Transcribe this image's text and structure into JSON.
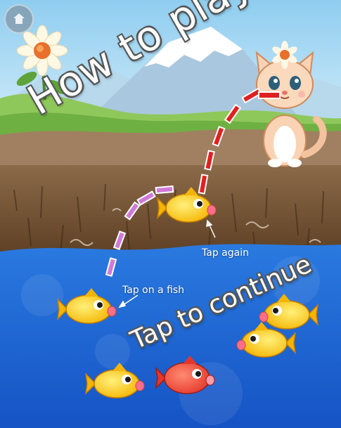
{
  "title": "How to play",
  "call_to_action": "Tap to continue",
  "hints": {
    "first": "Tap on a fish",
    "second": "Tap again"
  },
  "home_button": {
    "icon": "home-icon"
  },
  "colors": {
    "sky": "#9fd6f2",
    "soil": "#6a4a2e",
    "water": "#1e63d6",
    "path_first": "#d07ad8",
    "path_second": "#e02020"
  }
}
